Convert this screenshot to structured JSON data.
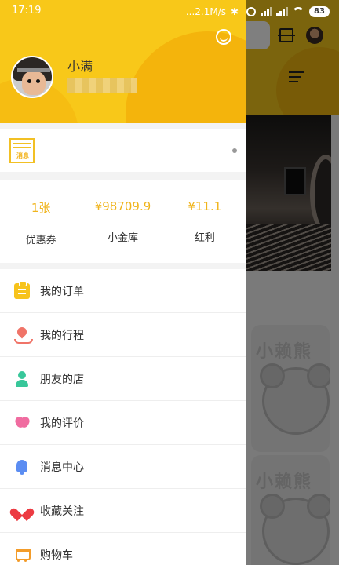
{
  "status_bar": {
    "time": "17:19",
    "network_speed": "...2.1M/s",
    "battery": "83"
  },
  "background_app": {
    "card_1_text": "小赖熊",
    "card_2_text": "小赖熊"
  },
  "drawer": {
    "profile": {
      "name": "小满"
    },
    "news_logo_text": "消息",
    "stats": [
      {
        "value": "1张",
        "label": "优惠券"
      },
      {
        "value": "¥98709.9",
        "label": "小金库"
      },
      {
        "value": "¥11.1",
        "label": "红利"
      }
    ],
    "menu": [
      {
        "label": "我的订单",
        "icon": "clipboard-icon"
      },
      {
        "label": "我的行程",
        "icon": "location-pin-icon"
      },
      {
        "label": "朋友的店",
        "icon": "person-icon"
      },
      {
        "label": "我的评价",
        "icon": "flower-icon"
      },
      {
        "label": "消息中心",
        "icon": "bell-icon"
      },
      {
        "label": "收藏关注",
        "icon": "heart-icon"
      },
      {
        "label": "购物车",
        "icon": "cart-icon"
      }
    ]
  },
  "colors": {
    "accent_yellow": "#f8c819",
    "stat_value": "#f0b41c",
    "overlay": "rgba(0,0,0,0.5)"
  }
}
